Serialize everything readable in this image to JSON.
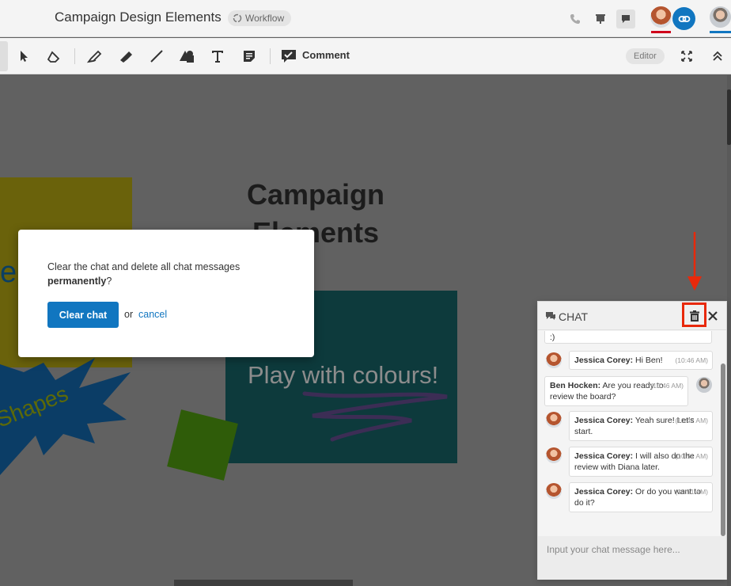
{
  "header": {
    "title": "Campaign Design Elements",
    "workflow_label": "Workflow",
    "icons": [
      "phone-icon",
      "presentation-icon",
      "chat-icon",
      "link-icon"
    ]
  },
  "toolbar": {
    "comment_label": "Comment",
    "editor_label": "Editor"
  },
  "canvas": {
    "heading": "Campaign Elements",
    "partial_letter": "e",
    "shapes_label": "Shapes",
    "colours_label": "Play with colours!"
  },
  "modal": {
    "message": "Clear the chat and delete all chat messages",
    "message_bold": "permanently",
    "message_end": "?",
    "confirm_button": "Clear chat",
    "or_text": "or",
    "cancel_link": "cancel"
  },
  "chat": {
    "title": "CHAT",
    "partial_message": ":)",
    "messages": [
      {
        "author": "Jessica Corey:",
        "text": " Hi Ben!",
        "time": "(10:46 AM)"
      },
      {
        "author": "Ben Hocken:",
        "text": " Are you ready to review the board?",
        "time": "(10:46 AM)"
      },
      {
        "author": "Jessica Corey:",
        "text": " Yeah sure! Let's start.",
        "time": "(10:47 AM)"
      },
      {
        "author": "Jessica Corey:",
        "text": " I will also do the review with Diana later.",
        "time": "(10:51 AM)"
      },
      {
        "author": "Jessica Corey:",
        "text": " Or do you want to do it?",
        "time": "(10:51 AM)"
      }
    ],
    "input_placeholder": "Input your chat message here..."
  },
  "colors": {
    "accent": "#1176c0",
    "highlight": "#e8290b",
    "presence_red": "#d0021b"
  }
}
